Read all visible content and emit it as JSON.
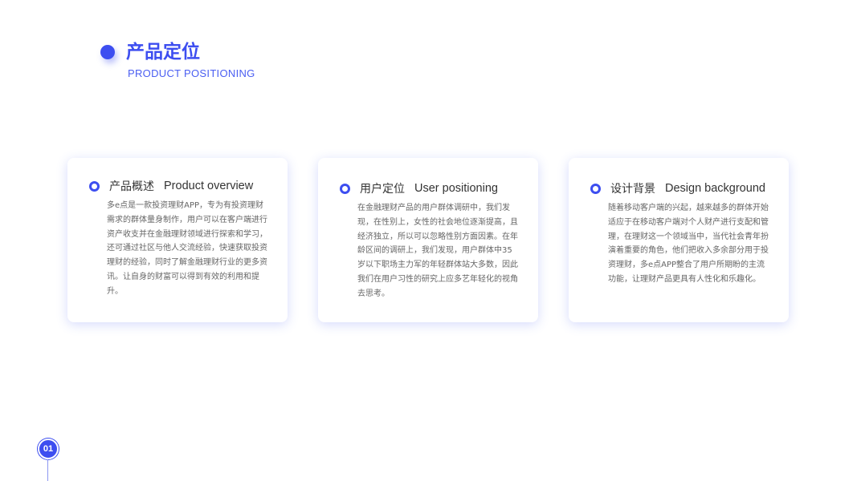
{
  "header": {
    "title": "产品定位",
    "subtitle": "PRODUCT POSITIONING"
  },
  "cards": [
    {
      "title_cn": "产品概述",
      "title_en": "Product overview",
      "body": "多e点是一款投资理财APP，专为有投资理财需求的群体量身制作，用户可以在客户端进行资产收支并在金融理财领域进行探索和学习，还可通过社区与他人交流经验，快速获取投资理财的经验，同时了解金融理财行业的更多资讯。让自身的财富可以得到有效的利用和提升。"
    },
    {
      "title_cn": "用户定位",
      "title_en": "User positioning",
      "body": "在金融理财产品的用户群体调研中，我们发现，在性别上，女性的社会地位逐渐提高，且经济独立，所以可以忽略性别方面因素。在年龄区间的调研上，我们发现，用户群体中35岁以下职场主力军的年轻群体站大多数，因此我们在用户习性的研究上应多艺年轻化的视角去思考。"
    },
    {
      "title_cn": "设计背景",
      "title_en": "Design background",
      "body": "随着移动客户端的兴起，越来越多的群体开始适应于在移动客户端对个人财产进行支配和管理，在理财这一个领域当中，当代社会青年扮演着重要的角色，他们把收入多余部分用于投资理财，多e点APP整合了用户所期盼的主流功能，让理财产品更具有人性化和乐趣化。"
    }
  ],
  "footer": {
    "page_number": "01"
  },
  "colors": {
    "accent": "#3d4ef0",
    "text": "#333333",
    "body_text": "#666666"
  }
}
